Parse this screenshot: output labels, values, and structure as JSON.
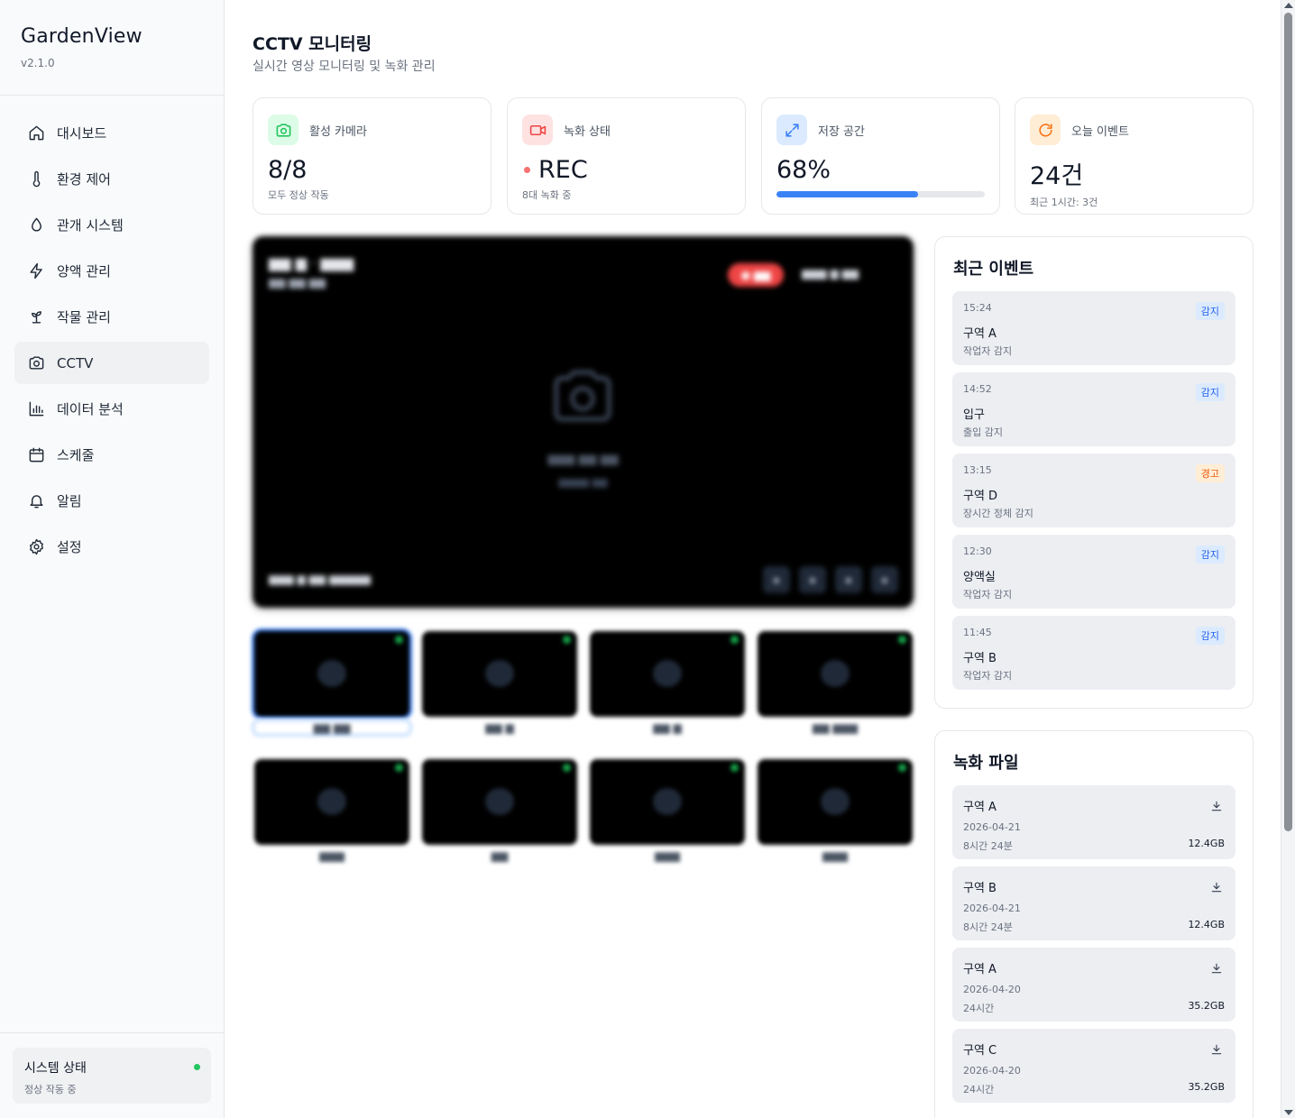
{
  "app": {
    "name": "GardenView",
    "version": "v2.1.0"
  },
  "sidebar": {
    "items": [
      {
        "label": "대시보드",
        "icon": "home-icon"
      },
      {
        "label": "환경 제어",
        "icon": "thermometer-icon"
      },
      {
        "label": "관개 시스템",
        "icon": "droplet-icon"
      },
      {
        "label": "양액 관리",
        "icon": "zap-icon"
      },
      {
        "label": "작물 관리",
        "icon": "sprout-icon"
      },
      {
        "label": "CCTV",
        "icon": "camera-icon",
        "active": true
      },
      {
        "label": "데이터 분석",
        "icon": "bar-chart-icon"
      },
      {
        "label": "스케줄",
        "icon": "calendar-icon"
      },
      {
        "label": "알림",
        "icon": "bell-icon"
      },
      {
        "label": "설정",
        "icon": "settings-icon"
      }
    ],
    "status": {
      "title": "시스템 상태",
      "sub": "정상 작동 중",
      "color": "#22c55e"
    }
  },
  "header": {
    "title": "CCTV 모니터링",
    "subtitle": "실시간 영상 모니터링 및 녹화 관리"
  },
  "stats": [
    {
      "label": "활성 카메라",
      "value": "8/8",
      "sub": "모두 정상 작동",
      "icon": "camera-icon",
      "color": "#22c55e"
    },
    {
      "label": "녹화 상태",
      "value": "REC",
      "sub": "8대 녹화 중",
      "icon": "video-icon",
      "color": "#ef4444"
    },
    {
      "label": "저장 공간",
      "value": "68%",
      "sub": "",
      "icon": "expand-icon",
      "color": "#3b82f6",
      "progress": 0.68
    },
    {
      "label": "오늘 이벤트",
      "value": "24건",
      "sub": "최근 1시간: 3건",
      "icon": "refresh-icon",
      "color": "#f97316"
    }
  ],
  "events": {
    "title": "최근 이벤트",
    "items": [
      {
        "time": "15:24",
        "zone": "구역 A",
        "desc": "작업자 감지",
        "badge": "감지",
        "type": "blue"
      },
      {
        "time": "14:52",
        "zone": "입구",
        "desc": "출입 감지",
        "badge": "감지",
        "type": "blue"
      },
      {
        "time": "13:15",
        "zone": "구역 D",
        "desc": "장시간 정체 감지",
        "badge": "경고",
        "type": "orange"
      },
      {
        "time": "12:30",
        "zone": "양액실",
        "desc": "작업자 감지",
        "badge": "감지",
        "type": "blue"
      },
      {
        "time": "11:45",
        "zone": "구역 B",
        "desc": "작업자 감지",
        "badge": "감지",
        "type": "blue"
      }
    ]
  },
  "recordings": {
    "title": "녹화 파일",
    "items": [
      {
        "zone": "구역 A",
        "date": "2026-04-21",
        "duration": "8시간 24분",
        "size": "12.4GB"
      },
      {
        "zone": "구역 B",
        "date": "2026-04-21",
        "duration": "8시간 24분",
        "size": "12.4GB"
      },
      {
        "zone": "구역 A",
        "date": "2026-04-20",
        "duration": "24시간",
        "size": "35.2GB"
      },
      {
        "zone": "구역 C",
        "date": "2026-04-20",
        "duration": "24시간",
        "size": "35.2GB"
      }
    ]
  }
}
